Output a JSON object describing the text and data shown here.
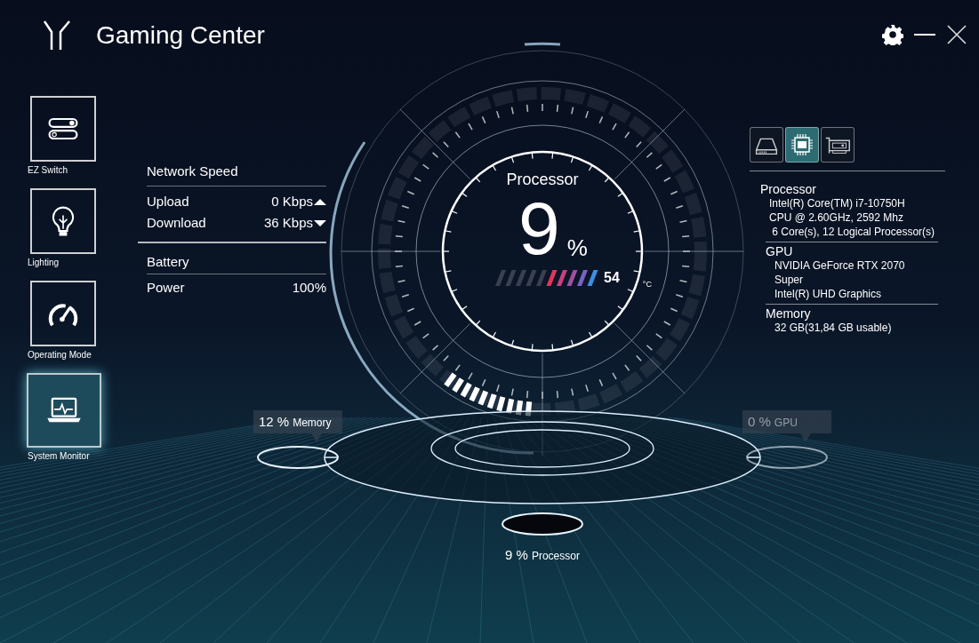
{
  "window": {
    "title": "Gaming Center"
  },
  "sidebar": {
    "items": [
      {
        "label": "EZ Switch",
        "kind": "switch",
        "selected": false
      },
      {
        "label": "Lighting",
        "kind": "bulb",
        "selected": false
      },
      {
        "label": "Operating Mode",
        "kind": "gauge",
        "selected": false
      },
      {
        "label": "System Monitor",
        "kind": "monitor",
        "selected": true
      }
    ]
  },
  "network": {
    "title": "Network Speed",
    "rows": [
      {
        "label": "Upload",
        "value": "0 Kbps",
        "kind": "upload"
      },
      {
        "label": "Download",
        "value": "36 Kbps",
        "kind": "download"
      }
    ]
  },
  "battery": {
    "title": "Battery",
    "rows": [
      {
        "label": "Power",
        "value": "100%"
      }
    ]
  },
  "gauge": {
    "title": "Processor",
    "value": "9",
    "unit": "%",
    "temperature": "54",
    "temperature_unit": "°C",
    "temperature_bar": {
      "level": 0.5
    }
  },
  "device_tabs": [
    {
      "kind": "storage",
      "selected": false
    },
    {
      "kind": "cpu",
      "selected": true
    },
    {
      "kind": "gpu",
      "selected": false
    }
  ],
  "specs": [
    {
      "title": "Processor",
      "lines": [
        "Intel(R) Core(TM) i7-10750H",
        "CPU @ 2.60GHz, 2592 Mhz",
        " 6 Core(s), 12 Logical Processor(s)"
      ]
    },
    {
      "title": "GPU",
      "lines": [
        "NVIDIA GeForce RTX 2070",
        "Super",
        "Intel(R) UHD Graphics"
      ]
    },
    {
      "title": "Memory",
      "lines": [
        "32 GB(31,84 GB usable)"
      ]
    }
  ],
  "nodes": [
    {
      "kind": "memory",
      "value": "12 %",
      "label": "Memory",
      "active": true
    },
    {
      "kind": "gpu",
      "value": "0 %",
      "label": "GPU",
      "active": false
    },
    {
      "kind": "processor",
      "value": "9 %",
      "label": "Processor",
      "active": true
    }
  ]
}
